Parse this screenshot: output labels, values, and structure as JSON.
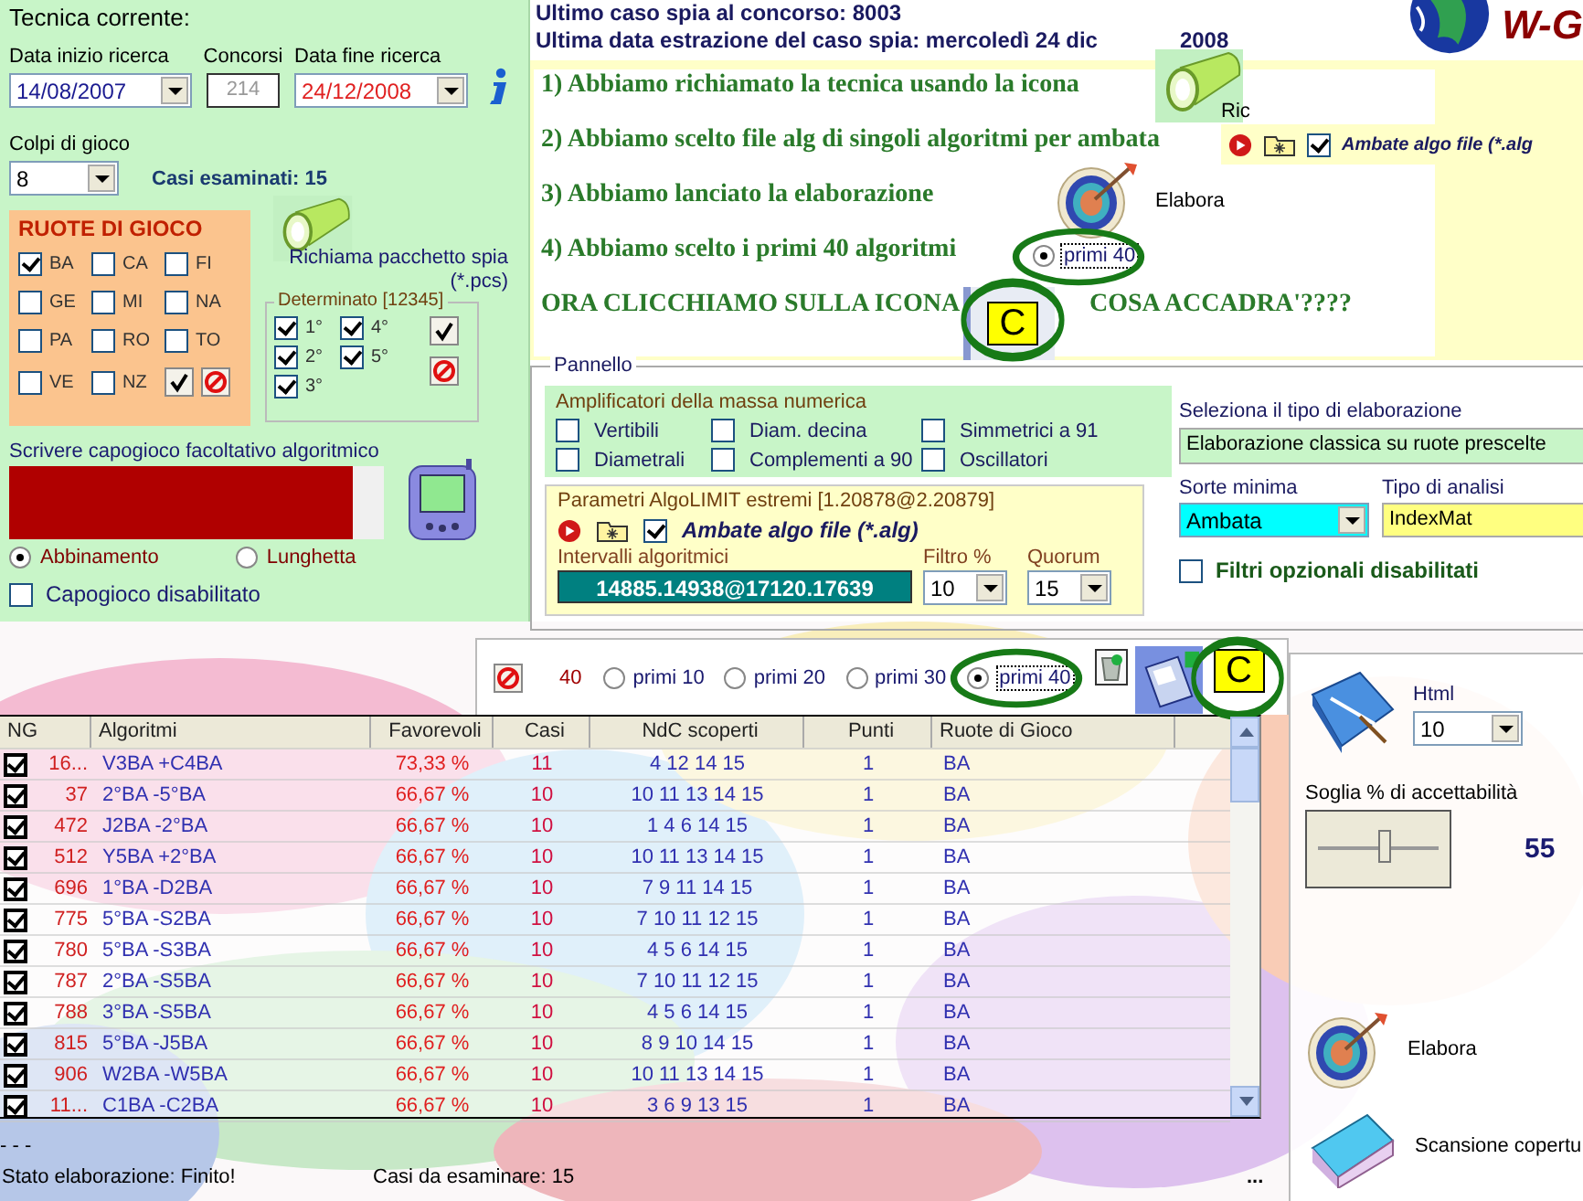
{
  "tecnica": {
    "title": "Tecnica corrente:",
    "fields": [
      {
        "label": "Data inizio ricerca",
        "value": "14/08/2007",
        "kind": "select"
      },
      {
        "label": "Concorsi",
        "value": "214",
        "kind": "readonly",
        "disabled": true
      },
      {
        "label": "Data fine ricerca",
        "value": "24/12/2008",
        "kind": "select"
      }
    ],
    "colpi": {
      "label": "Colpi di gioco",
      "value": "8"
    },
    "casi_esaminati": "Casi esaminati: 15",
    "ruote": {
      "title": "RUOTE DI GIOCO",
      "items": [
        {
          "label": "BA",
          "checked": true
        },
        {
          "label": "CA",
          "checked": false
        },
        {
          "label": "FI",
          "checked": false
        },
        {
          "label": "GE",
          "checked": false
        },
        {
          "label": "MI",
          "checked": false
        },
        {
          "label": "NA",
          "checked": false
        },
        {
          "label": "PA",
          "checked": false
        },
        {
          "label": "RO",
          "checked": false
        },
        {
          "label": "TO",
          "checked": false
        },
        {
          "label": "VE",
          "checked": false
        },
        {
          "label": "NZ",
          "checked": false
        }
      ]
    },
    "richiama": "Richiama pacchetto spia (*.pcs)",
    "determinato": {
      "title": "Determinato [12345]",
      "items": [
        {
          "label": "1°",
          "checked": true
        },
        {
          "label": "4°",
          "checked": true
        },
        {
          "label": "2°",
          "checked": true
        },
        {
          "label": "5°",
          "checked": true
        },
        {
          "label": "3°",
          "checked": true
        }
      ]
    },
    "capogioco_label": "Scrivere capogioco facoltativo algoritmico",
    "modes": [
      {
        "label": "Abbinamento",
        "selected": true
      },
      {
        "label": "Lunghetta",
        "selected": false
      }
    ],
    "capogioco_disabilitato": {
      "label": "Capogioco disabilitato",
      "checked": false
    }
  },
  "header": {
    "line1": "Ultimo caso spia al concorso:  8003",
    "line2": "Ultima data estrazione del caso spia: mercoledì 24 dic",
    "line2_tail": "2008",
    "logo": "W-G"
  },
  "note": {
    "lines": [
      "1) Abbiamo richiamato la tecnica usando la icona",
      "2) Abbiamo scelto file alg di singoli algoritmi per ambata",
      "3) Abbiamo lanciato la elaborazione",
      "4) Abbiamo scelto i primi 40 algoritmi"
    ],
    "final": "ORA CLICCHIAMO SULLA ICONA",
    "final_tail": "COSA ACCADRA'????",
    "ric": "Ric",
    "ambate": {
      "label": "Ambate algo file (*.alg",
      "checked": true
    },
    "elabora": "Elabora",
    "radio": {
      "label": "primi 40",
      "selected": true
    },
    "c_button": "C"
  },
  "pannello": {
    "title": "Pannello",
    "amplificatori": {
      "title": "Amplificatori della massa numerica",
      "items": [
        {
          "label": "Vertibili",
          "checked": false
        },
        {
          "label": "Diam. decina",
          "checked": false
        },
        {
          "label": "Simmetrici a 91",
          "checked": false
        },
        {
          "label": "Diametrali",
          "checked": false
        },
        {
          "label": "Complementi a 90",
          "checked": false
        },
        {
          "label": "Oscillatori",
          "checked": false
        }
      ]
    },
    "parametri": {
      "title": "Parametri AlgoLIMIT estremi [1.20878@2.20879]",
      "ambate": {
        "label": "Ambate algo file (*.alg)",
        "checked": true
      },
      "intervalli_label": "Intervalli algoritmici",
      "intervalli": "14885.14938@17120.17639",
      "filtro_label": "Filtro %",
      "filtro": "10",
      "quorum_label": "Quorum",
      "quorum": "15"
    },
    "tipo_label": "Seleziona il tipo di elaborazione",
    "tipo": "Elaborazione classica su ruote prescelte",
    "sorte_label": "Sorte minima",
    "sorte": "Ambata",
    "analisi_label": "Tipo di analisi",
    "analisi": "IndexMat",
    "filtri": {
      "label": "Filtri opzionali disabilitati",
      "checked": false
    }
  },
  "toolbar": {
    "count": "40",
    "options": [
      {
        "label": "primi 10",
        "selected": false
      },
      {
        "label": "primi 20",
        "selected": false
      },
      {
        "label": "primi 30",
        "selected": false
      },
      {
        "label": "primi 40",
        "selected": true
      }
    ],
    "c_button": "C"
  },
  "table": {
    "columns": [
      "NG",
      "Algoritmi",
      "Favorevoli",
      "Casi",
      "NdC scoperti",
      "Punti",
      "Ruote di Gioco"
    ],
    "rows": [
      {
        "checked": true,
        "ng": "16...",
        "alg": "V3BA +C4BA",
        "fav": "73,33 %",
        "casi": "11",
        "ndc": "4 12 14 15",
        "punti": "1",
        "ruote": "BA"
      },
      {
        "checked": true,
        "ng": "37",
        "alg": "2°BA -5°BA",
        "fav": "66,67 %",
        "casi": "10",
        "ndc": "10 11 13 14 15",
        "punti": "1",
        "ruote": "BA"
      },
      {
        "checked": true,
        "ng": "472",
        "alg": "J2BA -2°BA",
        "fav": "66,67 %",
        "casi": "10",
        "ndc": "1 4 6 14 15",
        "punti": "1",
        "ruote": "BA"
      },
      {
        "checked": true,
        "ng": "512",
        "alg": "Y5BA +2°BA",
        "fav": "66,67 %",
        "casi": "10",
        "ndc": "10 11 13 14 15",
        "punti": "1",
        "ruote": "BA"
      },
      {
        "checked": true,
        "ng": "696",
        "alg": "1°BA -D2BA",
        "fav": "66,67 %",
        "casi": "10",
        "ndc": "7 9 11 14 15",
        "punti": "1",
        "ruote": "BA"
      },
      {
        "checked": true,
        "ng": "775",
        "alg": "5°BA -S2BA",
        "fav": "66,67 %",
        "casi": "10",
        "ndc": "7 10 11 12 15",
        "punti": "1",
        "ruote": "BA"
      },
      {
        "checked": true,
        "ng": "780",
        "alg": "5°BA -S3BA",
        "fav": "66,67 %",
        "casi": "10",
        "ndc": "4 5 6 14 15",
        "punti": "1",
        "ruote": "BA"
      },
      {
        "checked": true,
        "ng": "787",
        "alg": "2°BA -S5BA",
        "fav": "66,67 %",
        "casi": "10",
        "ndc": "7 10 11 12 15",
        "punti": "1",
        "ruote": "BA"
      },
      {
        "checked": true,
        "ng": "788",
        "alg": "3°BA -S5BA",
        "fav": "66,67 %",
        "casi": "10",
        "ndc": "4 5 6 14 15",
        "punti": "1",
        "ruote": "BA"
      },
      {
        "checked": true,
        "ng": "815",
        "alg": "5°BA -J5BA",
        "fav": "66,67 %",
        "casi": "10",
        "ndc": "8 9 10 14 15",
        "punti": "1",
        "ruote": "BA"
      },
      {
        "checked": true,
        "ng": "906",
        "alg": "W2BA -W5BA",
        "fav": "66,67 %",
        "casi": "10",
        "ndc": "10 11 13 14 15",
        "punti": "1",
        "ruote": "BA"
      },
      {
        "checked": true,
        "ng": "11...",
        "alg": "C1BA -C2BA",
        "fav": "66,67 %",
        "casi": "10",
        "ndc": "3 6 9 13 15",
        "punti": "1",
        "ruote": "BA"
      }
    ]
  },
  "status": {
    "dots": "- - -",
    "state": "Stato elaborazione:  Finito!",
    "casi": "Casi da esaminare: 15",
    "more": "..."
  },
  "side": {
    "html_label": "Html",
    "html_value": "10",
    "soglia_label": "Soglia % di accettabilità",
    "soglia": {
      "level": 0.55
    },
    "soglia_value": "55",
    "elabora": "Elabora",
    "scansione": "Scansione copertu"
  }
}
